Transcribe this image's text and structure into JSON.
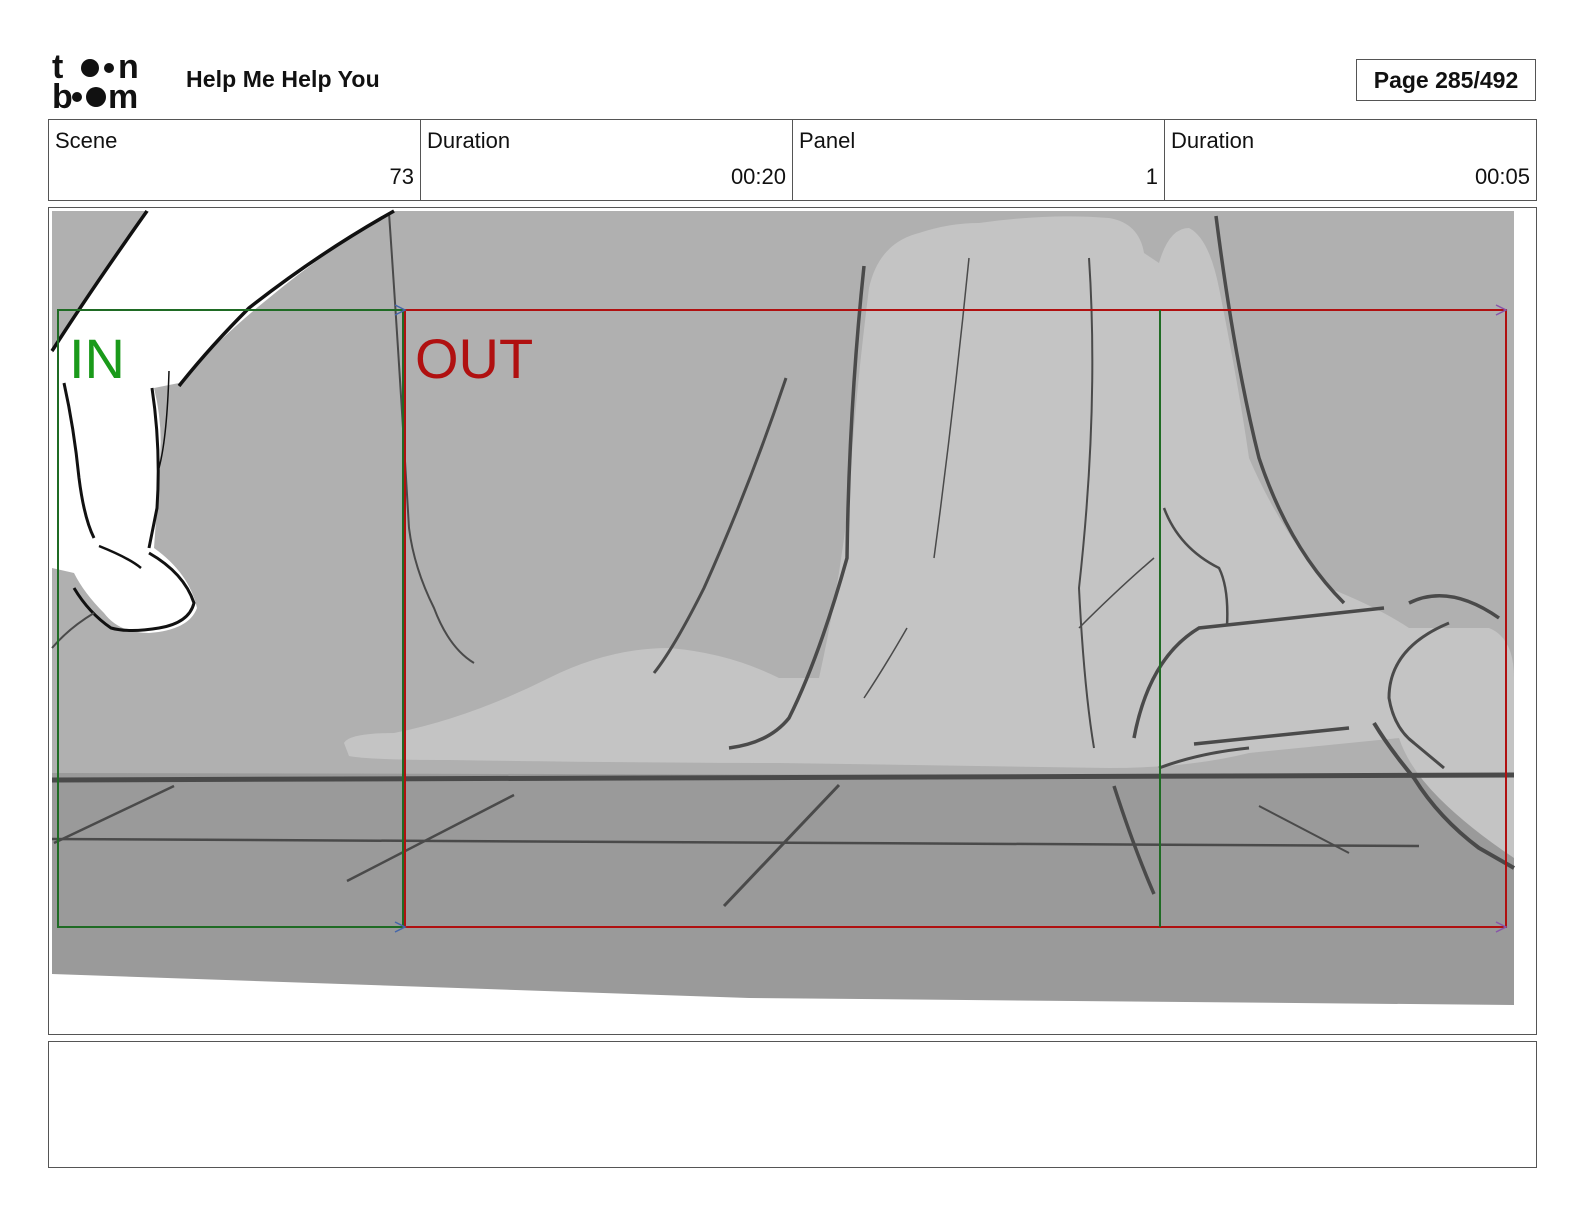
{
  "header": {
    "project_title": "Help Me Help You",
    "page_label": "Page 285/492",
    "logo": {
      "name": "toon-boom-logo",
      "text": "toon boom"
    }
  },
  "info": {
    "scene_label": "Scene",
    "scene_value": "73",
    "scene_duration_label": "Duration",
    "scene_duration_value": "00:20",
    "panel_label": "Panel",
    "panel_value": "1",
    "panel_duration_label": "Duration",
    "panel_duration_value": "00:05"
  },
  "panel": {
    "in_label": "IN",
    "out_label": "OUT",
    "in_color": "#1a9a1a",
    "out_color": "#b01010"
  },
  "notes": {
    "text": ""
  }
}
